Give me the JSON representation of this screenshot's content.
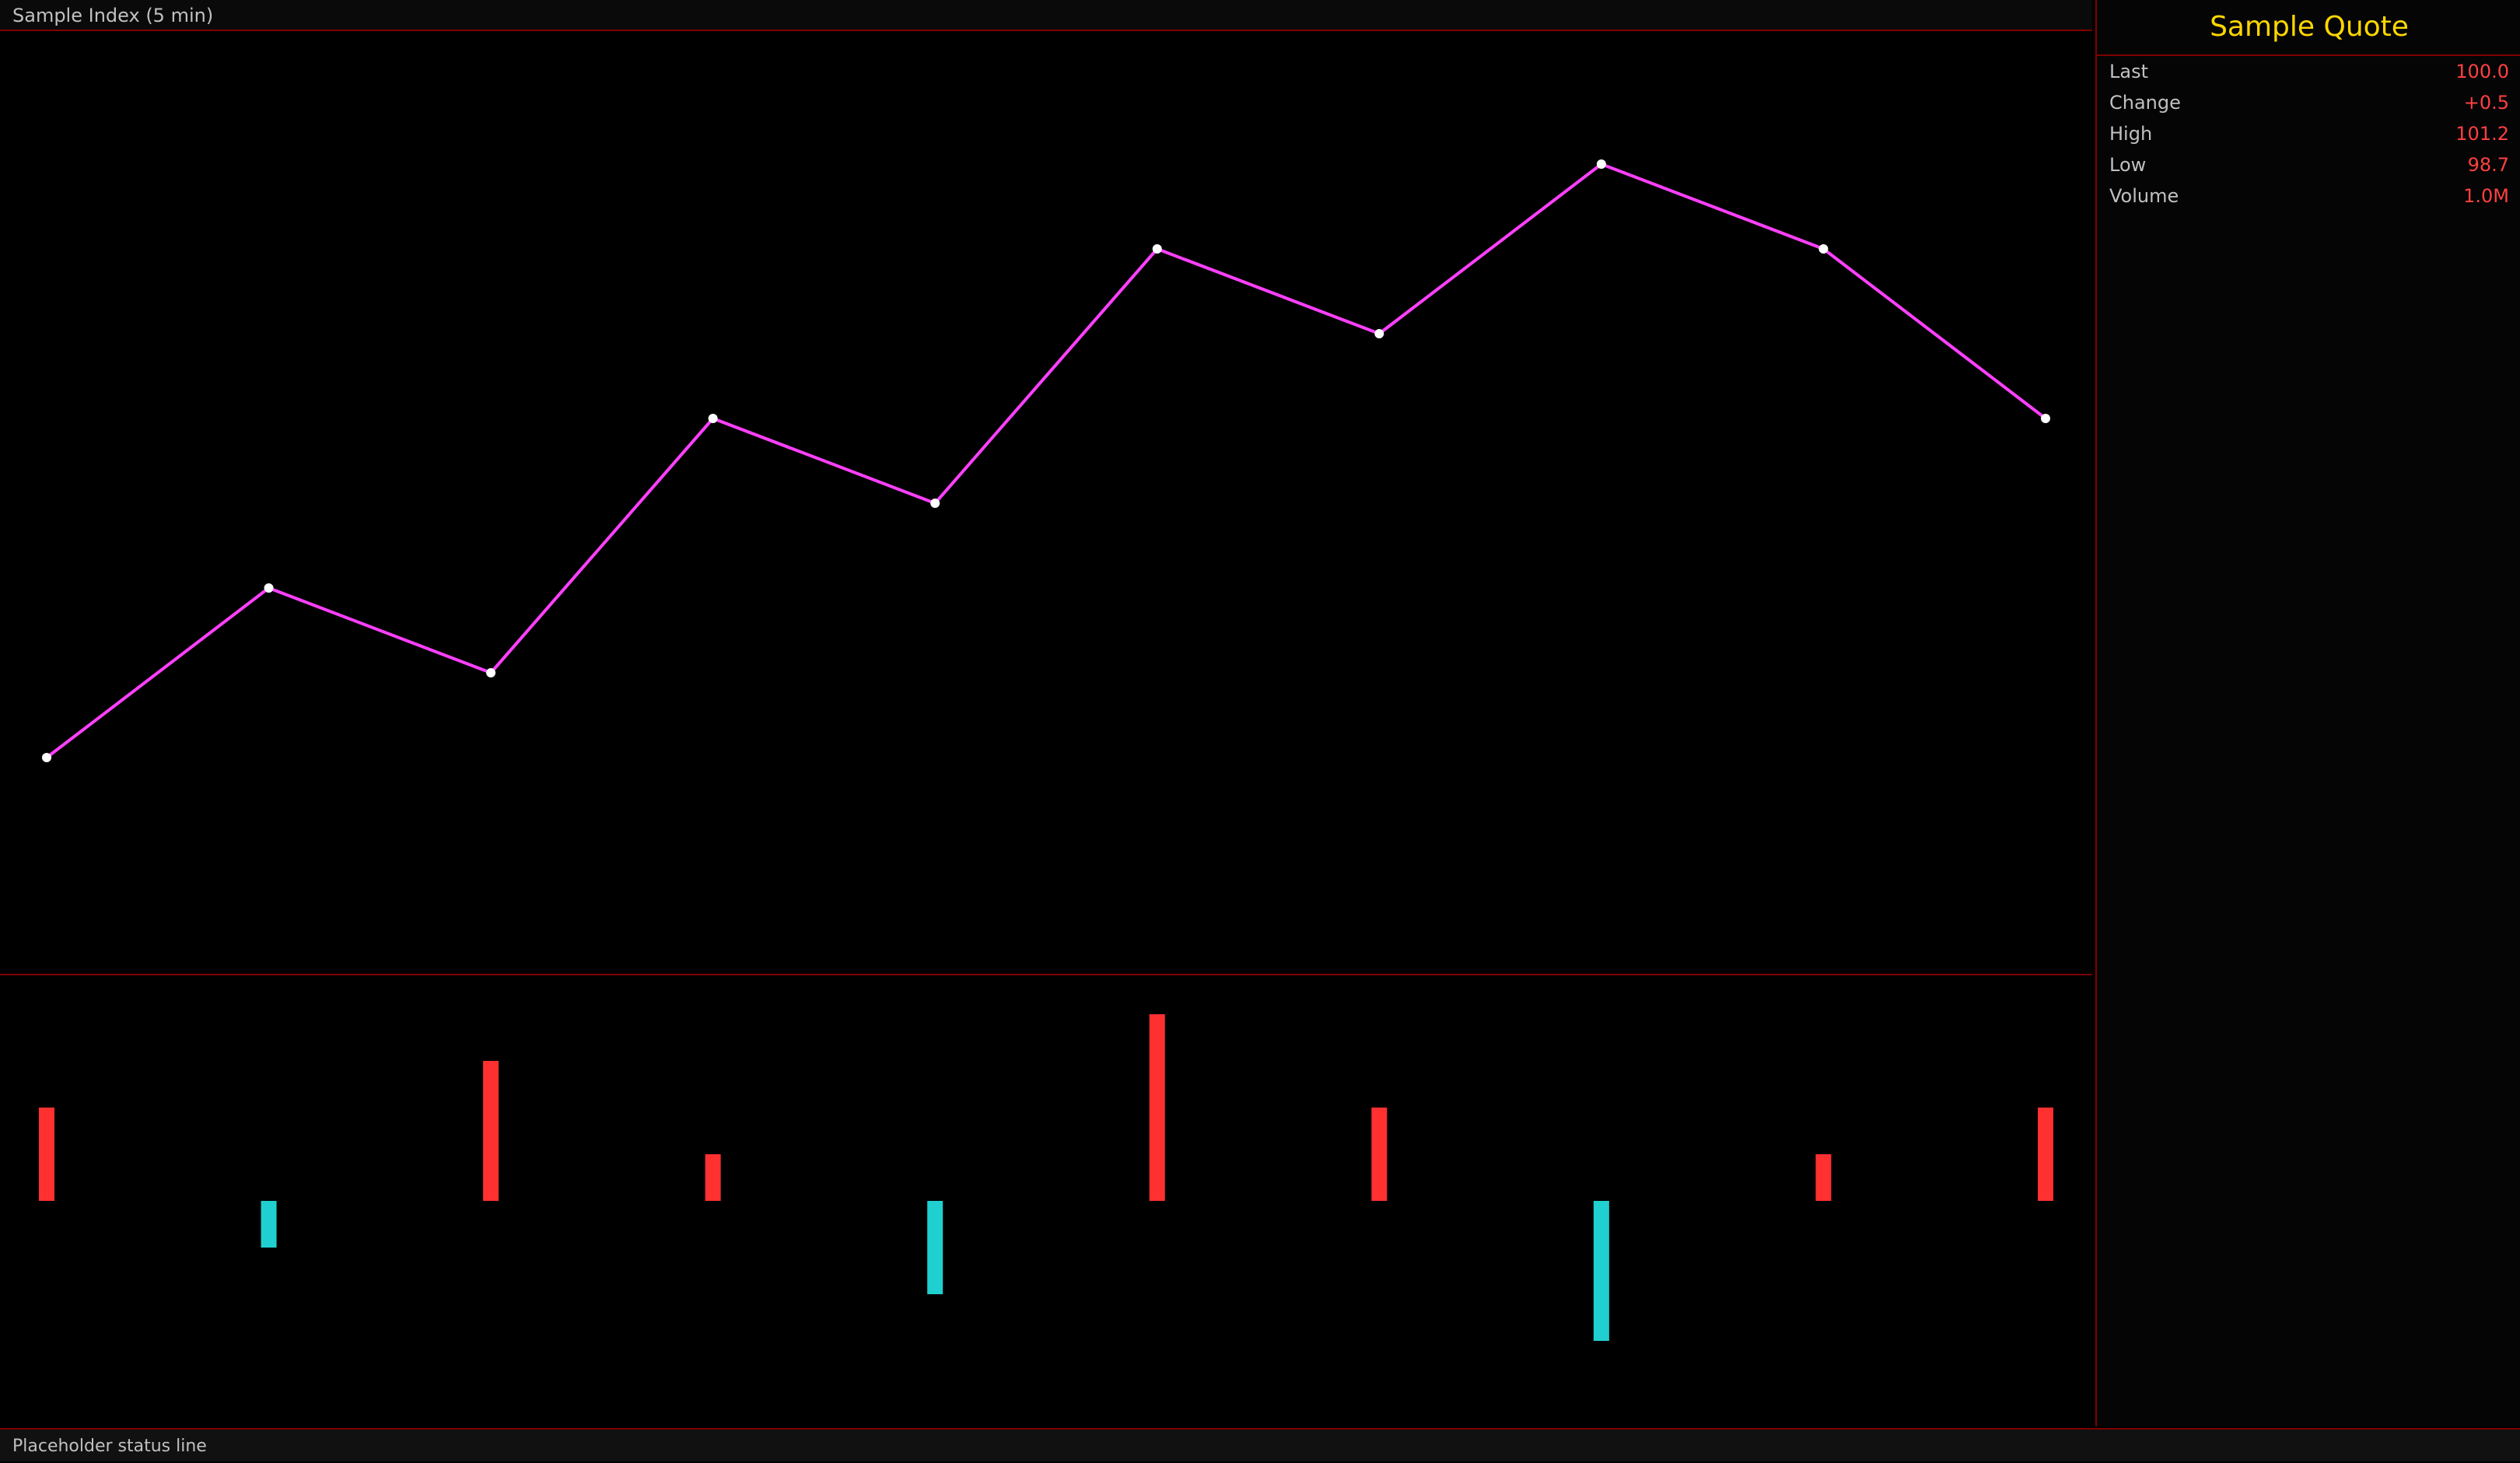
{
  "header": {
    "caption": "Sample Index (5 min)"
  },
  "side": {
    "title": "Sample Quote",
    "rows": [
      {
        "label": "Last",
        "value": "100.0"
      },
      {
        "label": "Change",
        "value": "+0.5"
      },
      {
        "label": "High",
        "value": "101.2"
      },
      {
        "label": "Low",
        "value": "98.7"
      },
      {
        "label": "Volume",
        "value": "1.0M"
      }
    ]
  },
  "footer": {
    "status": "Placeholder status line"
  },
  "chart_data": {
    "type": "line",
    "x": [
      1,
      2,
      3,
      4,
      5,
      6,
      7,
      8,
      9,
      10
    ],
    "series": [
      {
        "values": [
          98,
          99,
          98.5,
          100,
          99.5,
          101,
          100.5,
          101.5,
          101,
          100
        ]
      }
    ],
    "ylim": [
      97,
      102
    ],
    "bars": [
      0.2,
      -0.1,
      0.3,
      0.1,
      -0.2,
      0.4,
      0.2,
      -0.3,
      0.1,
      0.2
    ]
  }
}
